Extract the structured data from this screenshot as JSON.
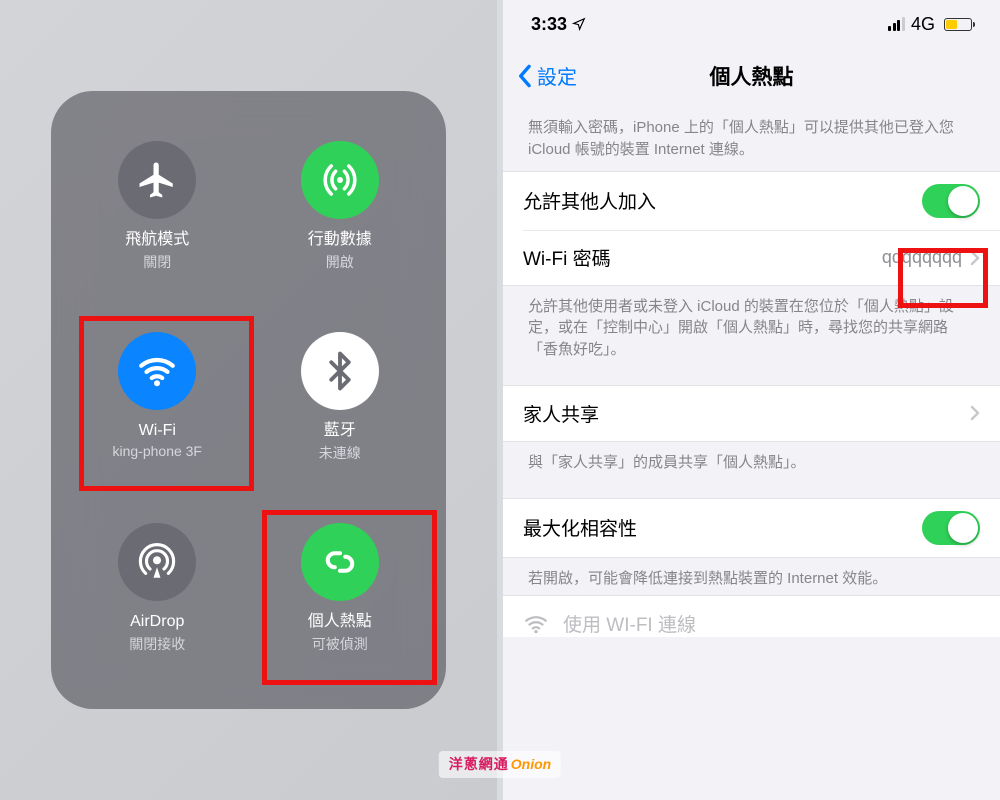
{
  "control_center": {
    "airplane": {
      "title": "飛航模式",
      "subtitle": "關閉"
    },
    "cellular": {
      "title": "行動數據",
      "subtitle": "開啟"
    },
    "wifi": {
      "title": "Wi-Fi",
      "subtitle": "king-phone 3F"
    },
    "bluetooth": {
      "title": "藍牙",
      "subtitle": "未連線"
    },
    "airdrop": {
      "title": "AirDrop",
      "subtitle": "關閉接收"
    },
    "hotspot": {
      "title": "個人熱點",
      "subtitle": "可被偵測"
    }
  },
  "status": {
    "time": "3:33",
    "network": "4G"
  },
  "nav": {
    "back": "設定",
    "title": "個人熱點"
  },
  "section1_desc": "無須輸入密碼，iPhone 上的「個人熱點」可以提供其他已登入您 iCloud 帳號的裝置 Internet 連線。",
  "row_allow": {
    "label": "允許其他人加入"
  },
  "row_password": {
    "label": "Wi-Fi 密碼",
    "value": "qqqqqqqq"
  },
  "section1_footer": "允許其他使用者或未登入 iCloud 的裝置在您位於「個人熱點」設定，或在「控制中心」開啟「個人熱點」時，尋找您的共享網路「香魚好吃」。",
  "row_family": {
    "label": "家人共享"
  },
  "family_footer": "與「家人共享」的成員共享「個人熱點」。",
  "row_compat": {
    "label": "最大化相容性"
  },
  "compat_footer": "若開啟，可能會降低連接到熱點裝置的 Internet 效能。",
  "row_wifi_connect": {
    "label": "使用 WI-FI 連線"
  },
  "watermark": {
    "cn": "洋蔥網通",
    "en": "Onion"
  }
}
